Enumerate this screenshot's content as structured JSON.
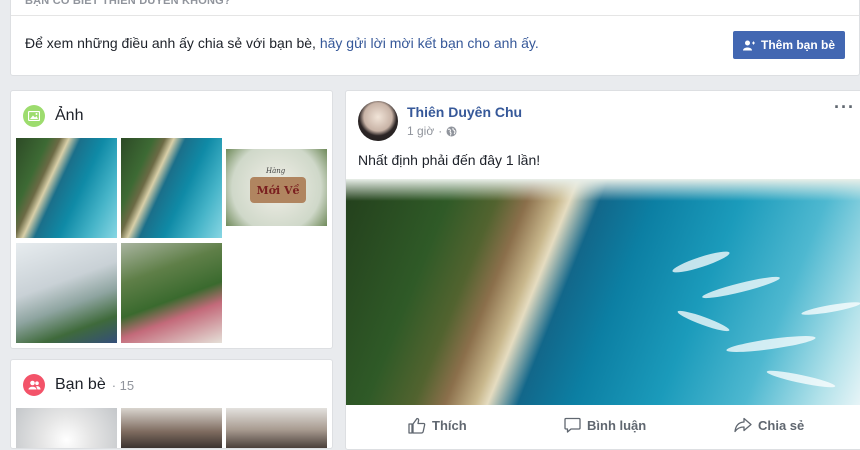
{
  "banner": {
    "heading": "BẠN CÓ BIẾT THIÊN DUYÊN KHÔNG?",
    "message_prefix": "Để xem những điều anh ấy chia sẻ với bạn bè,",
    "message_link": "hãy gửi lời mời kết bạn cho anh ấy.",
    "add_friend_label": "Thêm bạn bè"
  },
  "photos": {
    "title": "Ảnh",
    "sign_small": "Hàng",
    "sign_text": "Mới Về"
  },
  "friends": {
    "title": "Bạn bè",
    "count": "· 15"
  },
  "post": {
    "author": "Thiên Duyên Chu",
    "time": "1 giờ",
    "more": "···",
    "text": "Nhất định phải đến đây 1 lần!",
    "actions": {
      "like": "Thích",
      "comment": "Bình luận",
      "share": "Chia sẻ"
    }
  },
  "colors": {
    "link": "#365899",
    "button": "#4267b2",
    "photos_icon": "#9ddc6e",
    "friends_icon": "#f35369"
  }
}
